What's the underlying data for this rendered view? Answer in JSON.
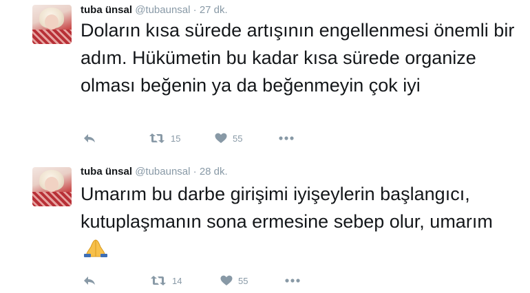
{
  "tweets": [
    {
      "name": "tuba ünsal",
      "handle": "@tubaunsal",
      "separator": "·",
      "time": "27 dk.",
      "text": "Doların kısa sürede artışının engellenmesi önemli bir adım. Hükümetin bu kadar kısa sürede organize olması beğenin ya da beğenmeyin çok iyi",
      "retweets": "15",
      "likes": "55",
      "icons": [
        "reply-icon",
        "retweet-icon",
        "heart-icon",
        "more-icon"
      ]
    },
    {
      "name": "tuba ünsal",
      "handle": "@tubaunsal",
      "separator": "·",
      "time": "28 dk.",
      "text": "Umarım bu darbe girişimi iyişeylerin başlangıcı, kutuplaşmanın sona ermesine sebep olur, umarım",
      "emoji": "folded-hands-emoji",
      "retweets": "14",
      "likes": "55",
      "icons": [
        "reply-icon",
        "retweet-icon",
        "heart-icon",
        "more-icon"
      ]
    }
  ],
  "colors": {
    "text": "#14171a",
    "muted": "#8899a6"
  }
}
